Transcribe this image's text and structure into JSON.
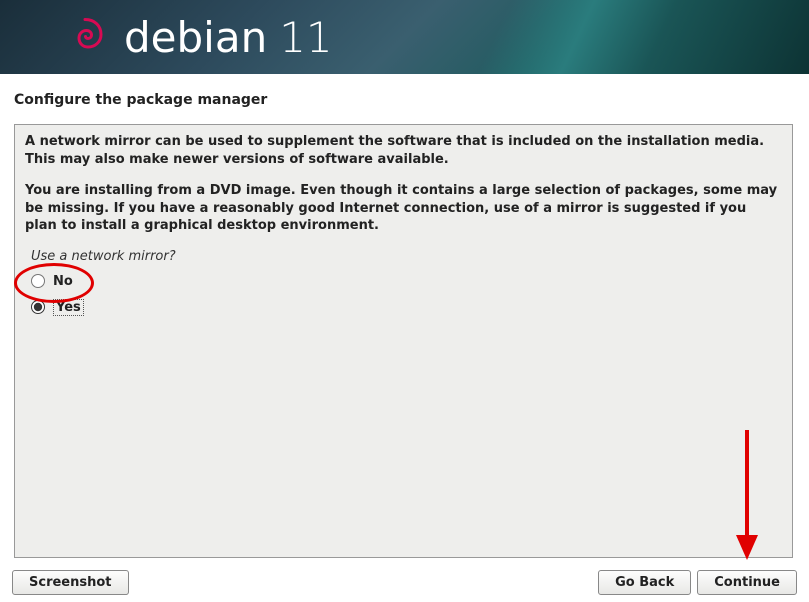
{
  "header": {
    "brand": "debian",
    "version": "11"
  },
  "page_title": "Configure the package manager",
  "description_line1": "A network mirror can be used to supplement the software that is included on the installation media. This may also make newer versions of software available.",
  "description_line2": "You are installing from a DVD image. Even though it contains a large selection of packages, some may be missing. If you have a reasonably good Internet connection, use of a mirror is suggested if you plan to install a graphical desktop environment.",
  "question": "Use a network mirror?",
  "options": {
    "no_label": "No",
    "yes_label": "Yes",
    "selected": "yes"
  },
  "buttons": {
    "screenshot": "Screenshot",
    "go_back": "Go Back",
    "continue": "Continue"
  }
}
